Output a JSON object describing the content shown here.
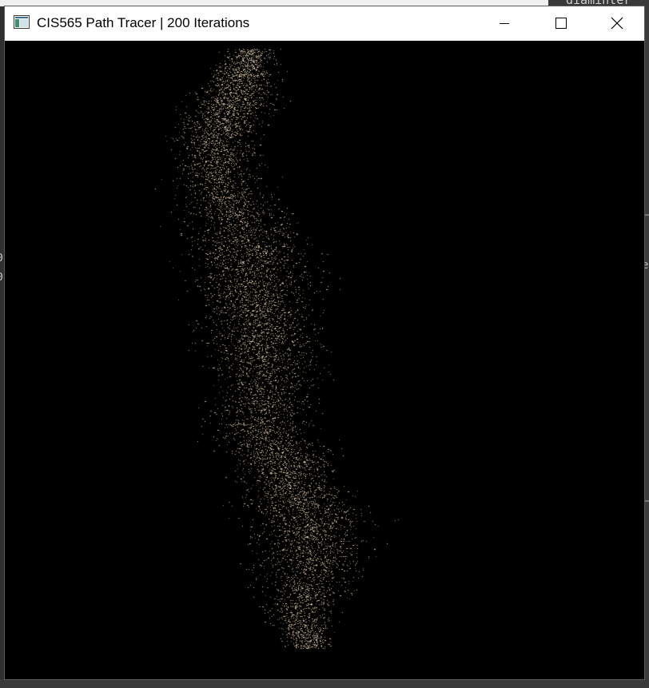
{
  "window": {
    "title": "CIS565 Path Tracer | 200 Iterations",
    "icon": "app-window-icon",
    "controls": {
      "minimize_icon": "minimize-icon",
      "maximize_icon": "maximize-icon",
      "close_icon": "close-icon"
    }
  },
  "background": {
    "top_right_fragment": "diaminter",
    "left_fragment_1": "0",
    "left_fragment_2": "0",
    "right_fragment": "e"
  },
  "render": {
    "background_color": "#000000",
    "particle_color": "#e8d2b0"
  }
}
